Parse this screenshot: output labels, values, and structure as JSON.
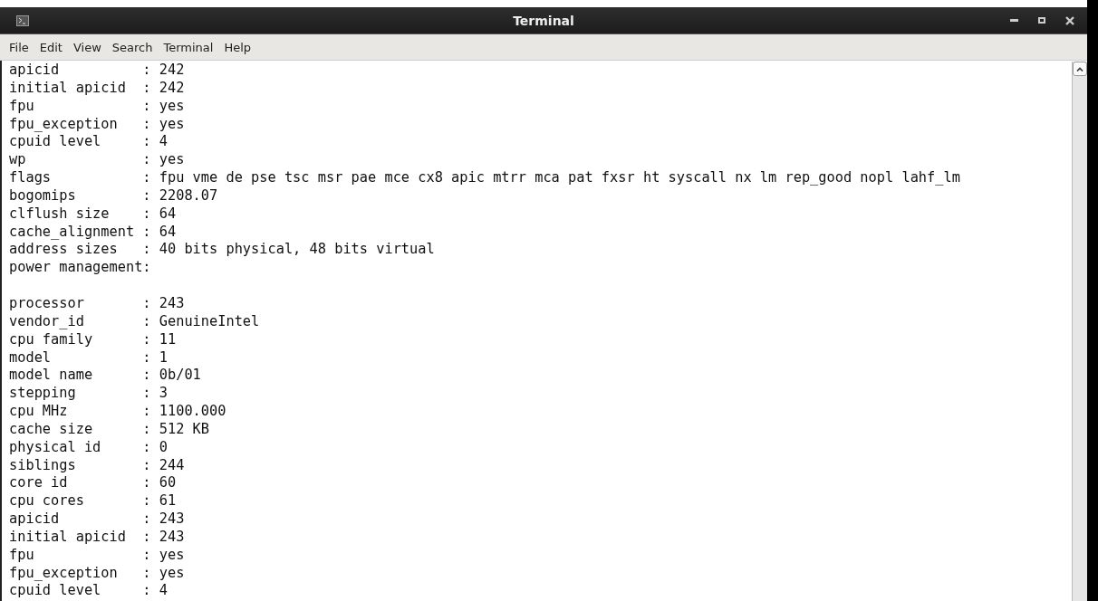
{
  "window": {
    "title": "Terminal"
  },
  "menu": [
    {
      "label": "File"
    },
    {
      "label": "Edit"
    },
    {
      "label": "View"
    },
    {
      "label": "Search"
    },
    {
      "label": "Terminal"
    },
    {
      "label": "Help"
    }
  ],
  "lines": [
    {
      "kind": "text",
      "text": "apicid          : 242"
    },
    {
      "kind": "text",
      "text": "initial apicid  : 242"
    },
    {
      "kind": "text",
      "text": "fpu             : yes"
    },
    {
      "kind": "text",
      "text": "fpu_exception   : yes"
    },
    {
      "kind": "text",
      "text": "cpuid level     : 4"
    },
    {
      "kind": "text",
      "text": "wp              : yes"
    },
    {
      "kind": "text",
      "text": "flags           : fpu vme de pse tsc msr pae mce cx8 apic mtrr mca pat fxsr ht syscall nx lm rep_good nopl lahf_lm"
    },
    {
      "kind": "text",
      "text": "bogomips        : 2208.07"
    },
    {
      "kind": "text",
      "text": "clflush size    : 64"
    },
    {
      "kind": "text",
      "text": "cache_alignment : 64"
    },
    {
      "kind": "text",
      "text": "address sizes   : 40 bits physical, 48 bits virtual"
    },
    {
      "kind": "text",
      "text": "power management:"
    },
    {
      "kind": "blank"
    },
    {
      "kind": "text",
      "text": "processor       : 243"
    },
    {
      "kind": "text",
      "text": "vendor_id       : GenuineIntel"
    },
    {
      "kind": "text",
      "text": "cpu family      : 11"
    },
    {
      "kind": "text",
      "text": "model           : 1"
    },
    {
      "kind": "text",
      "text": "model name      : 0b/01"
    },
    {
      "kind": "text",
      "text": "stepping        : 3"
    },
    {
      "kind": "text",
      "text": "cpu MHz         : 1100.000"
    },
    {
      "kind": "text",
      "text": "cache size      : 512 KB"
    },
    {
      "kind": "text",
      "text": "physical id     : 0"
    },
    {
      "kind": "text",
      "text": "siblings        : 244"
    },
    {
      "kind": "text",
      "text": "core id         : 60"
    },
    {
      "kind": "text",
      "text": "cpu cores       : 61"
    },
    {
      "kind": "text",
      "text": "apicid          : 243"
    },
    {
      "kind": "text",
      "text": "initial apicid  : 243"
    },
    {
      "kind": "text",
      "text": "fpu             : yes"
    },
    {
      "kind": "text",
      "text": "fpu_exception   : yes"
    },
    {
      "kind": "text",
      "text": "cpuid level     : 4"
    }
  ]
}
